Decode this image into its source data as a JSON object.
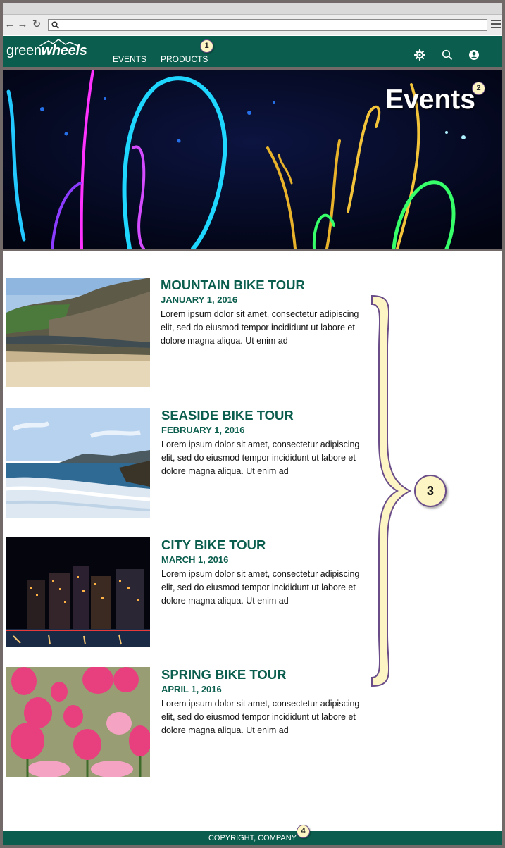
{
  "nav": {
    "logo_part1": "green",
    "logo_part2": "wheels",
    "links": [
      "EVENTS",
      "PRODUCTS"
    ]
  },
  "callouts": [
    "1",
    "2",
    "3",
    "4"
  ],
  "hero": {
    "title": "Events"
  },
  "events": [
    {
      "title": "MOUNTAIN BIKE TOUR",
      "date": "JANUARY 1, 2016",
      "description": "Lorem ipsum dolor sit amet, consectetur adipiscing elit, sed do eiusmod tempor incididunt ut labore et dolore magna aliqua. Ut enim ad"
    },
    {
      "title": "SEASIDE BIKE TOUR",
      "date": "FEBRUARY 1, 2016",
      "description": "Lorem ipsum dolor sit amet, consectetur adipiscing elit, sed do eiusmod tempor incididunt ut labore et dolore magna aliqua. Ut enim ad"
    },
    {
      "title": "CITY BIKE TOUR",
      "date": "MARCH 1, 2016",
      "description": "Lorem ipsum dolor sit amet, consectetur adipiscing elit, sed do eiusmod tempor incididunt ut labore et dolore magna aliqua. Ut enim ad"
    },
    {
      "title": "SPRING BIKE TOUR",
      "date": "APRIL 1, 2016",
      "description": "Lorem ipsum dolor sit amet, consectetur adipiscing elit, sed do eiusmod tempor incididunt ut labore et dolore magna aliqua. Ut enim ad"
    }
  ],
  "footer": {
    "text": "COPYRIGHT, COMPANY"
  },
  "icons": [
    "back-icon",
    "forward-icon",
    "reload-icon",
    "search-icon",
    "menu-icon",
    "settings-icon",
    "account-icon"
  ],
  "colors": {
    "brand": "#0b5e4d",
    "callout_fill": "#fdf6c4",
    "callout_border": "#6a4c88",
    "frame": "#726a68"
  }
}
